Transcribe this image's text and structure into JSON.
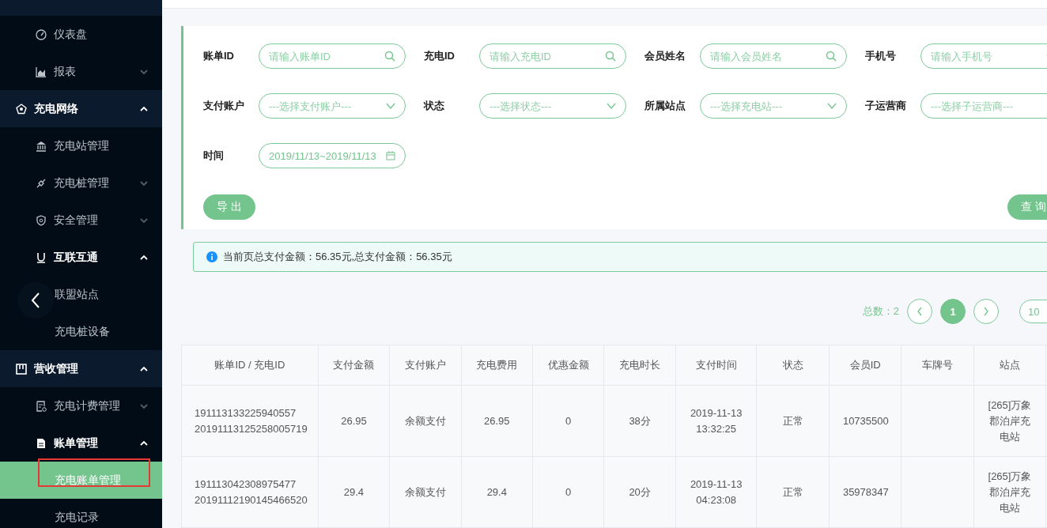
{
  "sidebar": {
    "items": [
      {
        "children": [
          {
            "label": "仪表盘",
            "selected": false
          },
          {
            "label": "报表",
            "expanded": false,
            "selected": false
          }
        ]
      },
      {
        "label": "充电网络",
        "expanded": true,
        "selected": false,
        "children": [
          {
            "label": "充电站管理",
            "selected": false
          },
          {
            "label": "充电桩管理",
            "expanded": false,
            "selected": false
          },
          {
            "label": "安全管理",
            "expanded": false,
            "selected": false
          },
          {
            "label": "互联互通",
            "expanded": true,
            "selected": false,
            "children": [
              {
                "label": "联盟站点",
                "selected": false
              },
              {
                "label": "充电桩设备",
                "selected": false
              }
            ]
          }
        ]
      },
      {
        "label": "营收管理",
        "expanded": true,
        "selected": false,
        "children": [
          {
            "label": "充电计费管理",
            "expanded": false,
            "selected": false
          },
          {
            "label": "账单管理",
            "expanded": true,
            "selected": false,
            "children": [
              {
                "label": "充电账单管理",
                "selected": true,
                "annotated": true
              },
              {
                "label": "充电记录",
                "selected": false
              }
            ]
          }
        ]
      }
    ]
  },
  "filters": [
    {
      "label": "账单ID",
      "kind": "search",
      "placeholder": "请输入账单ID"
    },
    {
      "label": "充电ID",
      "kind": "search",
      "placeholder": "请输入充电ID"
    },
    {
      "label": "会员姓名",
      "kind": "search",
      "placeholder": "请输入会员姓名"
    },
    {
      "label": "手机号",
      "kind": "search",
      "placeholder": "请输入手机号"
    },
    {
      "label": "支付账户",
      "kind": "select",
      "placeholder": "---选择支付账户---"
    },
    {
      "label": "状态",
      "kind": "select",
      "placeholder": "---选择状态---"
    },
    {
      "label": "所属站点",
      "kind": "select",
      "placeholder": "---选择充电站---"
    },
    {
      "label": "子运营商",
      "kind": "select",
      "placeholder": "---选择子运营商---"
    },
    {
      "label": "时间",
      "kind": "date",
      "value": "2019/11/13~2019/11/13"
    }
  ],
  "export_button": "导 出",
  "query_button": "查 询",
  "summary": "当前页总支付金额：56.35元,总支付金额：56.35元",
  "pagination": {
    "total": "总数：2",
    "pages": [
      {
        "label": "1",
        "selected": true
      }
    ],
    "page_size": "10"
  },
  "table": {
    "columns": [
      "账单ID / 充电ID",
      "支付金额",
      "支付账户",
      "充电费用",
      "优惠金额",
      "充电时长",
      "支付时间",
      "状态",
      "会员ID",
      "车牌号",
      "站点"
    ],
    "rows": [
      {
        "cells": [
          [
            "191113133225940557",
            "20191113125258005719"
          ],
          "26.95",
          "余额支付",
          "26.95",
          "0",
          "38分",
          "2019-11-13 13:32:25",
          "正常",
          "10735500",
          "",
          "[265]万象郡泊岸充电站"
        ]
      },
      {
        "cells": [
          [
            "191113042308975477",
            "20191112190145466520"
          ],
          "29.4",
          "余额支付",
          "29.4",
          "0",
          "20分",
          "2019-11-13 04:23:08",
          "正常",
          "35978347",
          "",
          "[265]万象郡泊岸充电站"
        ]
      }
    ]
  }
}
